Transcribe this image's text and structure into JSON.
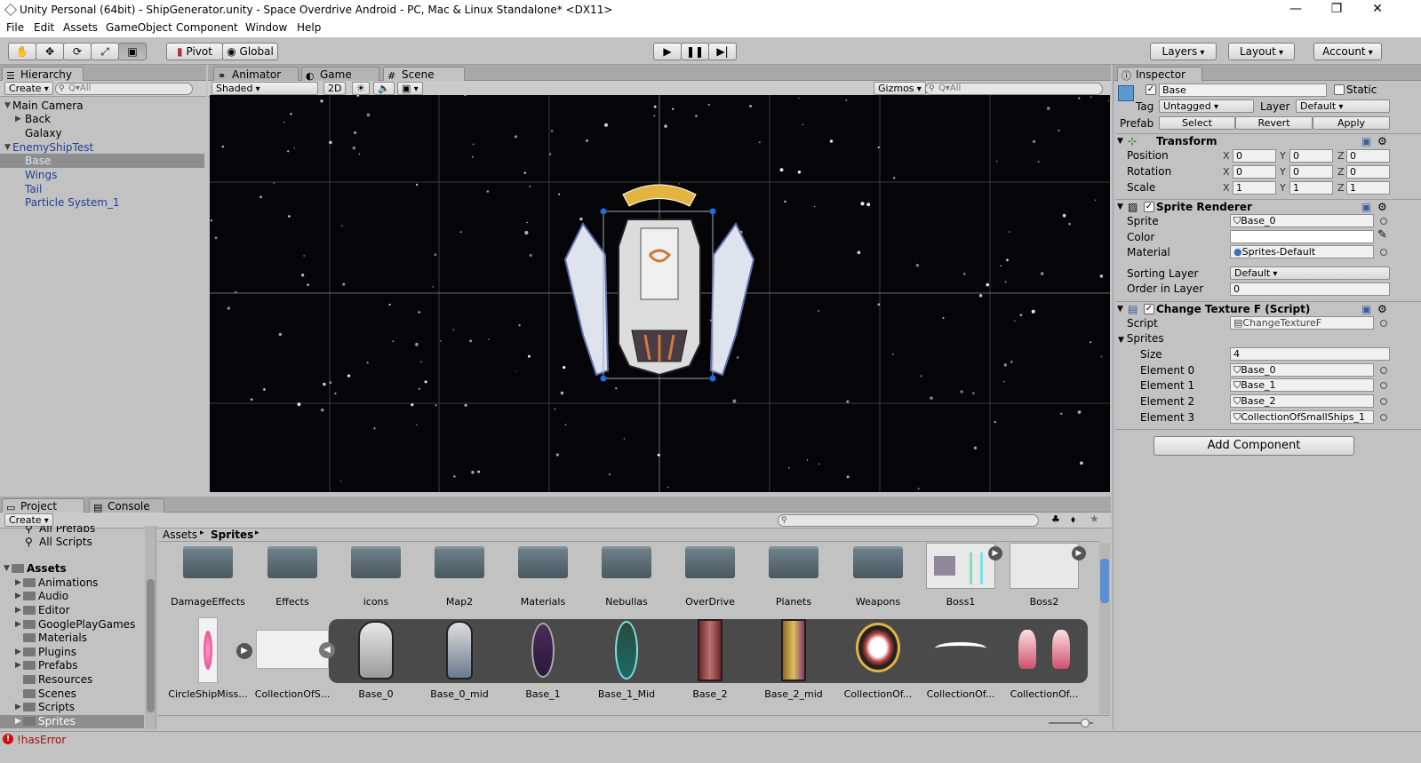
{
  "window": {
    "title": "Unity Personal (64bit) - ShipGenerator.unity - Space Overdrive Android - PC, Mac & Linux Standalone* <DX11>",
    "minimize": "—",
    "maximize": "❐",
    "close": "✕"
  },
  "menu": [
    "File",
    "Edit",
    "Assets",
    "GameObject",
    "Component",
    "Window",
    "Help"
  ],
  "toolbar": {
    "pivot": "Pivot",
    "global": "Global",
    "layers": "Layers",
    "layout": "Layout",
    "account": "Account"
  },
  "hierarchy": {
    "tab": "Hierarchy",
    "create": "Create",
    "search_placeholder": "Q▾All",
    "items": [
      "Main Camera",
      "Back",
      "Galaxy",
      "EnemyShipTest",
      "Base",
      "Wings",
      "Tail",
      "Particle System_1"
    ]
  },
  "sceneTabs": {
    "animator": "Animator",
    "game": "Game",
    "scene": "Scene"
  },
  "sceneBar": {
    "shading": "Shaded",
    "mode2d": "2D",
    "gizmos": "Gizmos",
    "search": "Q▾All"
  },
  "inspector": {
    "tab": "Inspector",
    "object_name": "Base",
    "static": "Static",
    "tag_label": "Tag",
    "tag_value": "Untagged",
    "layer_label": "Layer",
    "layer_value": "Default",
    "prefab_label": "Prefab",
    "select": "Select",
    "revert": "Revert",
    "apply": "Apply",
    "transform": {
      "title": "Transform",
      "position": {
        "label": "Position",
        "x": "0",
        "y": "0",
        "z": "0"
      },
      "rotation": {
        "label": "Rotation",
        "x": "0",
        "y": "0",
        "z": "0"
      },
      "scale": {
        "label": "Scale",
        "x": "1",
        "y": "1",
        "z": "1"
      }
    },
    "sprite_renderer": {
      "title": "Sprite Renderer",
      "sprite_label": "Sprite",
      "sprite_value": "Base_0",
      "color_label": "Color",
      "material_label": "Material",
      "material_value": "Sprites-Default",
      "sorting_label": "Sorting Layer",
      "sorting_value": "Default",
      "order_label": "Order in Layer",
      "order_value": "0"
    },
    "script_comp": {
      "title": "Change Texture F (Script)",
      "script_label": "Script",
      "script_value": "ChangeTextureF",
      "sprites_label": "Sprites",
      "size_label": "Size",
      "size_value": "4",
      "elements": [
        {
          "label": "Element 0",
          "value": "Base_0"
        },
        {
          "label": "Element 1",
          "value": "Base_1"
        },
        {
          "label": "Element 2",
          "value": "Base_2"
        },
        {
          "label": "Element 3",
          "value": "CollectionOfSmallShips_1"
        }
      ]
    },
    "add_component": "Add Component"
  },
  "project": {
    "tab": "Project",
    "console_tab": "Console",
    "create": "Create",
    "tree": [
      "All Prefabs",
      "All Scripts",
      "Assets",
      "Animations",
      "Audio",
      "Editor",
      "GooglePlayGames",
      "Materials",
      "Plugins",
      "Prefabs",
      "Resources",
      "Scenes",
      "Scripts",
      "Sprites"
    ],
    "breadcrumb": [
      "Assets",
      "Sprites"
    ],
    "folders": [
      "DamageEffects",
      "Effects",
      "icons",
      "Map2",
      "Materials",
      "Nebullas",
      "OverDrive",
      "Planets",
      "Weapons",
      "Boss1",
      "Boss2"
    ],
    "row2": [
      "CircleShipMiss...",
      "CollectionOfS...",
      "Base_0",
      "Base_0_mid",
      "Base_1",
      "Base_1_Mid",
      "Base_2",
      "Base_2_mid",
      "CollectionOf...",
      "CollectionOf...",
      "CollectionOf..."
    ]
  },
  "status": {
    "error": "!hasError"
  }
}
